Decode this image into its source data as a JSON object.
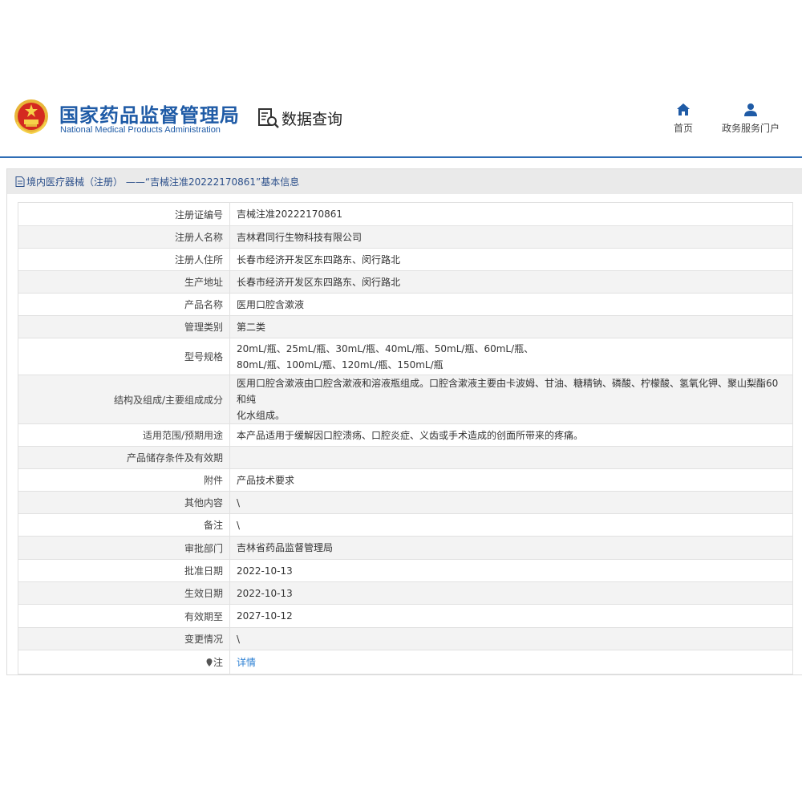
{
  "header": {
    "brand_cn": "国家药品监督管理局",
    "brand_en": "National Medical Products Administration",
    "query_label": "数据查询",
    "nav": [
      {
        "label": "首页",
        "icon": "home-icon"
      },
      {
        "label": "政务服务门户",
        "icon": "user-icon"
      }
    ]
  },
  "colors": {
    "brand": "#1f5ba6",
    "link": "#2b7fd3",
    "row_alt": "#f3f3f3"
  },
  "panel": {
    "title": "境内医疗器械（注册） ——“吉械注准20222170861”基本信息"
  },
  "rows": [
    {
      "key": "注册证编号",
      "value": "吉械注准20222170861"
    },
    {
      "key": "注册人名称",
      "value": "吉林君同行生物科技有限公司"
    },
    {
      "key": "注册人住所",
      "value": "长春市经济开发区东四路东、闵行路北"
    },
    {
      "key": "生产地址",
      "value": "长春市经济开发区东四路东、闵行路北"
    },
    {
      "key": "产品名称",
      "value": "医用口腔含漱液"
    },
    {
      "key": "管理类别",
      "value": "第二类"
    },
    {
      "key": "型号规格",
      "value": "20mL/瓶、25mL/瓶、30mL/瓶、40mL/瓶、50mL/瓶、60mL/瓶、",
      "value2": "80mL/瓶、100mL/瓶、120mL/瓶、150mL/瓶"
    },
    {
      "key": "结构及组成/主要组成成分",
      "value": "医用口腔含漱液由口腔含漱液和溶液瓶组成。口腔含漱液主要由卡波姆、甘油、糖精钠、磷酸、柠檬酸、氢氧化钾、聚山梨酯60和纯",
      "value2": "化水组成。"
    },
    {
      "key": "适用范围/预期用途",
      "value": "本产品适用于缓解因口腔溃疡、口腔炎症、义齿或手术造成的创面所带来的疼痛。"
    },
    {
      "key": "产品储存条件及有效期",
      "value": ""
    },
    {
      "key": "附件",
      "value": "产品技术要求"
    },
    {
      "key": "其他内容",
      "value": "\\"
    },
    {
      "key": "备注",
      "value": "\\"
    },
    {
      "key": "审批部门",
      "value": "吉林省药品监督管理局"
    },
    {
      "key": "批准日期",
      "value": "2022-10-13"
    },
    {
      "key": "生效日期",
      "value": "2022-10-13"
    },
    {
      "key": "有效期至",
      "value": "2027-10-12"
    },
    {
      "key": "变更情况",
      "value": "\\"
    },
    {
      "key": "注",
      "value": "详情"
    }
  ]
}
